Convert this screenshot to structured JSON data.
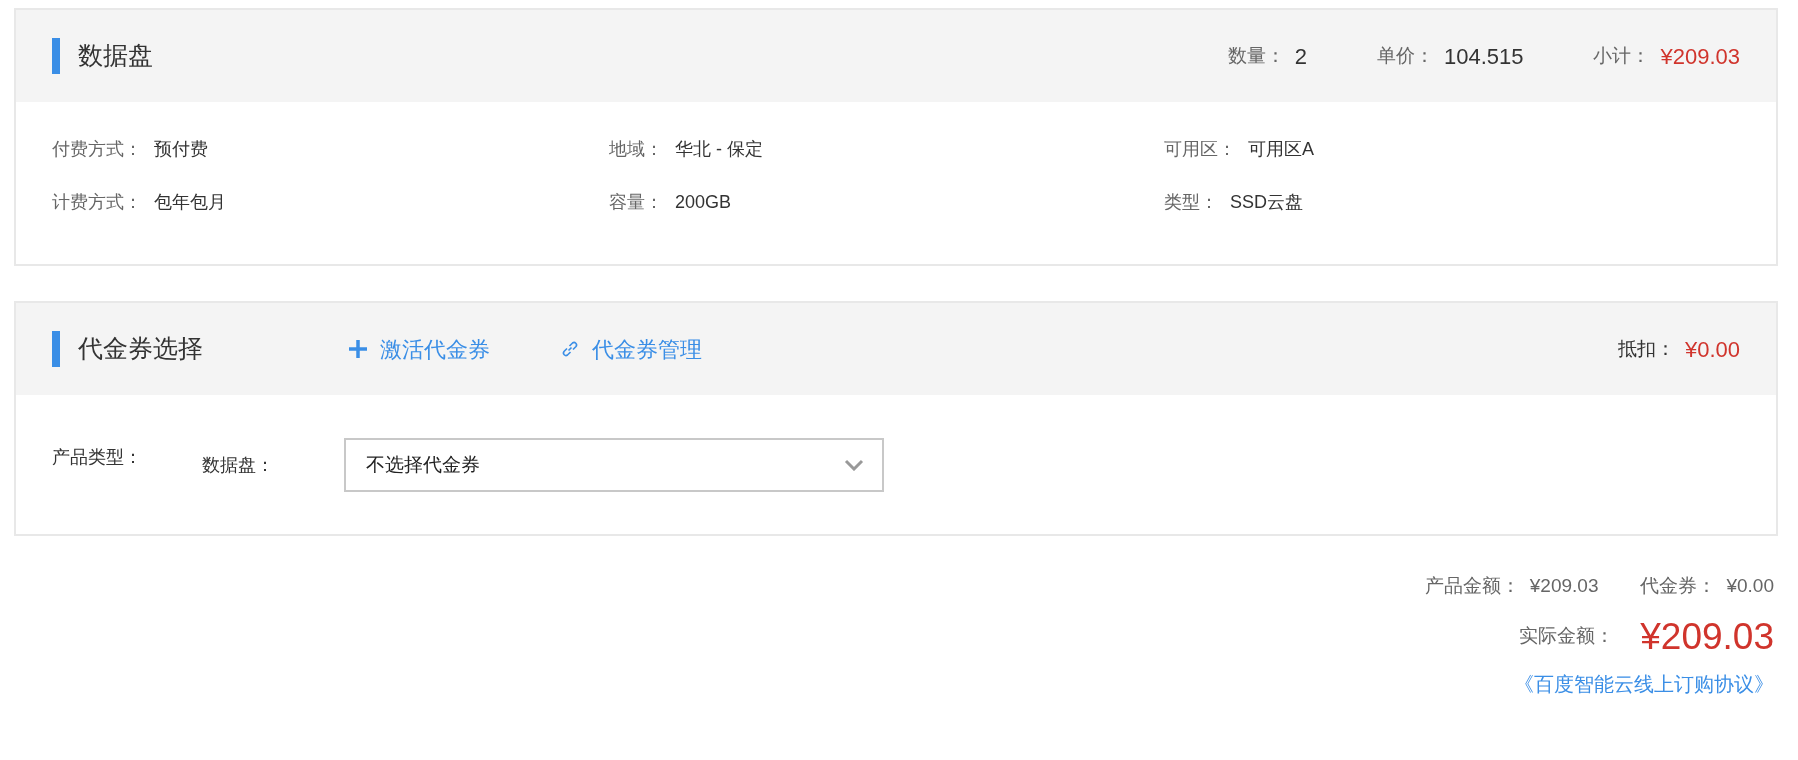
{
  "disk_card": {
    "title": "数据盘",
    "summary": [
      {
        "label": "数量：",
        "value": "2",
        "kind": "plain"
      },
      {
        "label": "单价：",
        "value": "104.515",
        "kind": "plain"
      },
      {
        "label": "小计：",
        "value": "¥209.03",
        "kind": "price"
      }
    ],
    "fields": [
      {
        "label": "付费方式：",
        "value": "预付费"
      },
      {
        "label": "地域：",
        "value": "华北 - 保定"
      },
      {
        "label": "可用区：",
        "value": "可用区A"
      },
      {
        "label": "计费方式：",
        "value": "包年包月"
      },
      {
        "label": "容量：",
        "value": "200GB"
      },
      {
        "label": "类型：",
        "value": "SSD云盘"
      }
    ]
  },
  "voucher_card": {
    "title": "代金券选择",
    "links": [
      {
        "label": "激活代金券",
        "kind": "plus"
      },
      {
        "label": "代金券管理",
        "kind": "link"
      }
    ],
    "deduction": {
      "label": "抵扣：",
      "value": "¥0.00"
    },
    "product_type_label": "产品类型：",
    "rows": [
      {
        "label": "数据盘：",
        "select_value": "不选择代金券"
      }
    ]
  },
  "totals": {
    "items": [
      {
        "label": "产品金额：",
        "value": "¥209.03"
      },
      {
        "label": "代金券：",
        "value": "¥0.00"
      }
    ],
    "actual": {
      "label": "实际金额：",
      "value": "¥209.03"
    },
    "agreement": "《百度智能云线上订购协议》"
  }
}
